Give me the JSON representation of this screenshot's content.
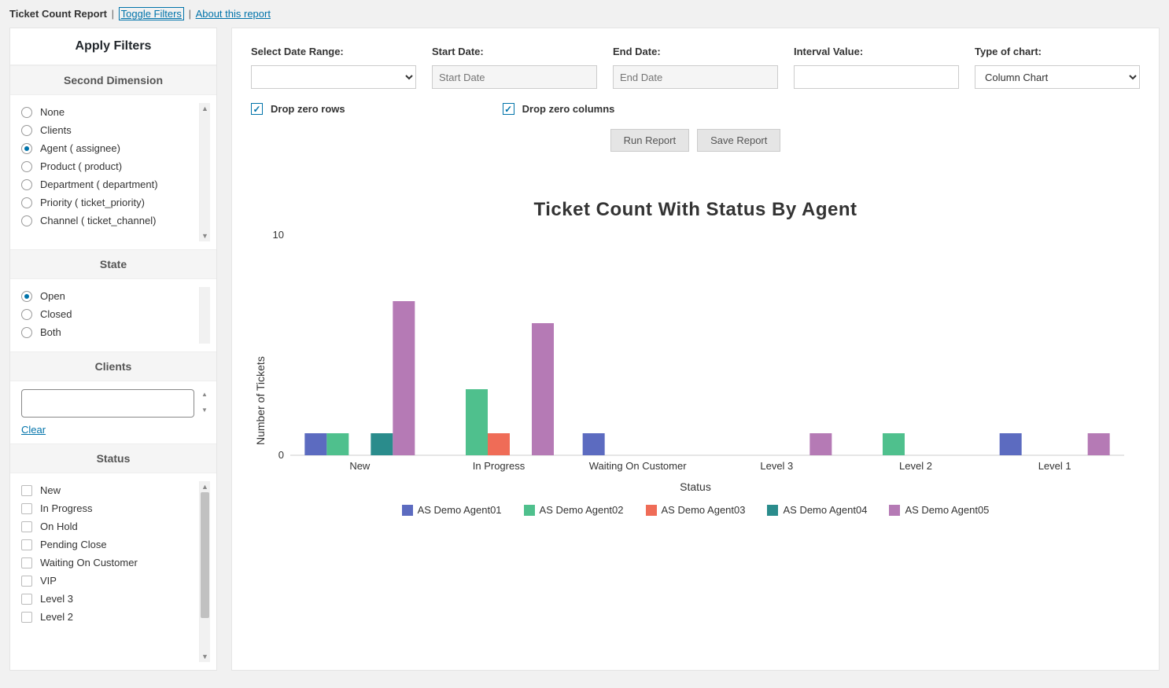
{
  "topbar": {
    "title": "Ticket Count Report",
    "toggle": "Toggle Filters",
    "about": "About this report"
  },
  "sidebar": {
    "apply": "Apply Filters",
    "second_dim": {
      "header": "Second Dimension",
      "items": [
        "None",
        "Clients",
        "Agent ( assignee)",
        "Product ( product)",
        "Department ( department)",
        "Priority ( ticket_priority)",
        "Channel ( ticket_channel)"
      ],
      "selected": 2
    },
    "state": {
      "header": "State",
      "items": [
        "Open",
        "Closed",
        "Both"
      ],
      "selected": 0
    },
    "clients": {
      "header": "Clients",
      "clear": "Clear"
    },
    "status": {
      "header": "Status",
      "items": [
        "New",
        "In Progress",
        "On Hold",
        "Pending Close",
        "Waiting On Customer",
        "VIP",
        "Level 3",
        "Level 2"
      ]
    }
  },
  "filters": {
    "date_range_label": "Select Date Range:",
    "start_label": "Start Date:",
    "start_ph": "Start Date",
    "end_label": "End Date:",
    "end_ph": "End Date",
    "interval_label": "Interval Value:",
    "chart_type_label": "Type of chart:",
    "chart_type_value": "Column Chart",
    "drop_rows": "Drop zero rows",
    "drop_cols": "Drop zero columns",
    "run": "Run Report",
    "save": "Save Report"
  },
  "chart_data": {
    "type": "bar",
    "title": "Ticket Count With Status By Agent",
    "xlabel": "Status",
    "ylabel": "Number of Tickets",
    "ylim": [
      0,
      10
    ],
    "categories": [
      "New",
      "In Progress",
      "Waiting On Customer",
      "Level 3",
      "Level 2",
      "Level 1"
    ],
    "series": [
      {
        "name": "AS Demo Agent01",
        "color": "#5c6bc0",
        "values": [
          1,
          0,
          1,
          0,
          0,
          1
        ]
      },
      {
        "name": "AS Demo Agent02",
        "color": "#4fc08d",
        "values": [
          1,
          3,
          0,
          0,
          1,
          0
        ]
      },
      {
        "name": "AS Demo Agent03",
        "color": "#ef6c57",
        "values": [
          0,
          1,
          0,
          0,
          0,
          0
        ]
      },
      {
        "name": "AS Demo Agent04",
        "color": "#2a8c8c",
        "values": [
          1,
          0,
          0,
          0,
          0,
          0
        ]
      },
      {
        "name": "AS Demo Agent05",
        "color": "#b57ab5",
        "values": [
          7,
          6,
          0,
          1,
          0,
          1
        ]
      }
    ]
  }
}
